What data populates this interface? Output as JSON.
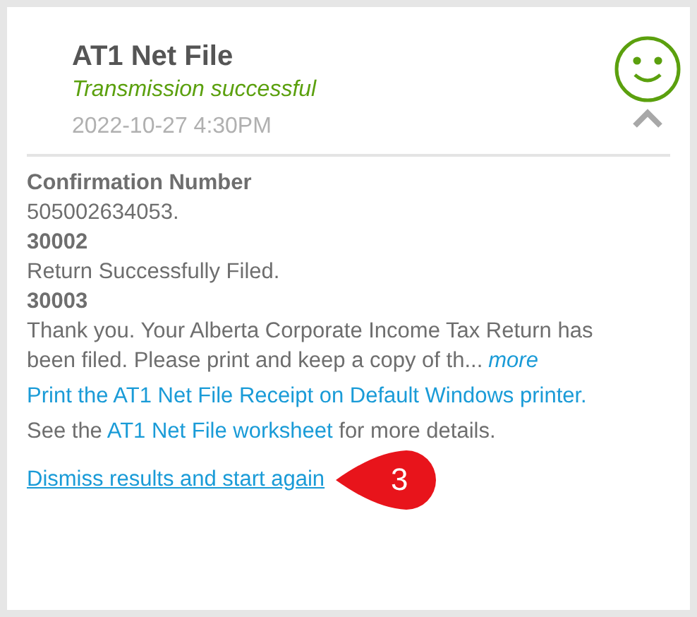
{
  "notification": {
    "title": "AT1 Net File",
    "status": "Transmission successful",
    "kind": "success",
    "timestamp": "2022-10-27 4:30PM",
    "expanded": true
  },
  "details": [
    {
      "kind": "heading",
      "text": "Confirmation Number"
    },
    {
      "kind": "text",
      "text": "505002634053."
    },
    {
      "kind": "heading",
      "text": "30002"
    },
    {
      "kind": "text",
      "text": "Return Successfully Filed."
    },
    {
      "kind": "heading",
      "text": "30003"
    }
  ],
  "message": {
    "text": "Thank you. Your Alberta Corporate Income Tax Return has been filed. Please print and keep a copy of th...",
    "more": "more"
  },
  "print_link": "Print the AT1 Net File Receipt on Default Windows printer.",
  "worksheet_note": {
    "before": "See the ",
    "link": "AT1 Net File worksheet",
    "after": " for more details."
  },
  "dismiss_link": "Dismiss results and start again",
  "callout": {
    "number": "3"
  }
}
